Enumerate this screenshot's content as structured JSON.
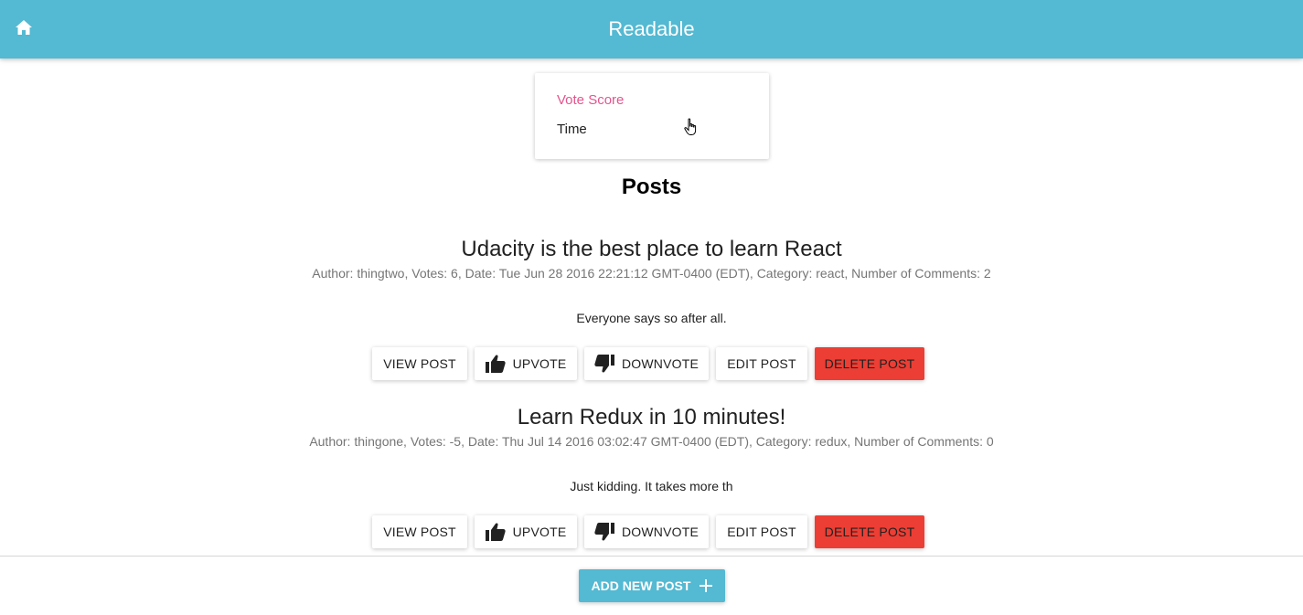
{
  "colors": {
    "appbar": "#54b9d2",
    "accent_pink": "#e4558c",
    "danger": "#ec3e34"
  },
  "header": {
    "title": "Readable",
    "home_icon": "home-icon"
  },
  "sort_menu": {
    "items": [
      {
        "label": "Vote Score",
        "selected": true
      },
      {
        "label": "Time",
        "selected": false
      }
    ]
  },
  "main": {
    "heading": "Posts"
  },
  "posts": [
    {
      "title": "Udacity is the best place to learn React",
      "meta": "Author: thingtwo, Votes: 6, Date: Tue Jun 28 2016 22:21:12 GMT-0400 (EDT), Category: react, Number of Comments: 2",
      "body": "Everyone says so after all."
    },
    {
      "title": "Learn Redux in 10 minutes!",
      "meta": "Author: thingone, Votes: -5, Date: Thu Jul 14 2016 03:02:47 GMT-0400 (EDT), Category: redux, Number of Comments: 0",
      "body": "Just kidding. It takes more th"
    }
  ],
  "buttons": {
    "view": "VIEW POST",
    "upvote": "UPVOTE",
    "downvote": "DOWNVOTE",
    "edit": "EDIT POST",
    "delete": "DELETE POST"
  },
  "footer": {
    "add_label": "ADD NEW POST",
    "add_icon": "plus-icon"
  }
}
